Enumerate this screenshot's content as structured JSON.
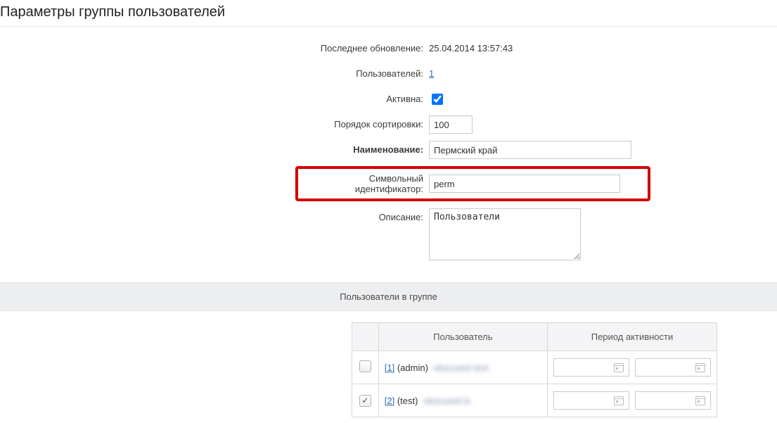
{
  "page": {
    "title": "Параметры группы пользователей"
  },
  "form": {
    "last_update_label": "Последнее обновление:",
    "last_update_value": "25.04.2014 13:57:43",
    "users_label": "Пользователей:",
    "users_value": "1",
    "active_label": "Активна:",
    "active_checked": true,
    "sort_label": "Порядок сортировки:",
    "sort_value": "100",
    "name_label": "Наименование:",
    "name_value": "Пермский край",
    "code_label": "Символьный идентификатор:",
    "code_value": "perm",
    "desc_label": "Описание:",
    "desc_value": "Пользователи"
  },
  "section": {
    "users_in_group": "Пользователи в группе"
  },
  "table": {
    "col_user": "Пользователь",
    "col_period": "Период активности",
    "rows": [
      {
        "checked": false,
        "id_link": "[1]",
        "login": "(admin)",
        "blurred_name": "obscured text"
      },
      {
        "checked": true,
        "id_link": "[2]",
        "login": "(test)",
        "blurred_name": "obscured tx"
      }
    ]
  }
}
